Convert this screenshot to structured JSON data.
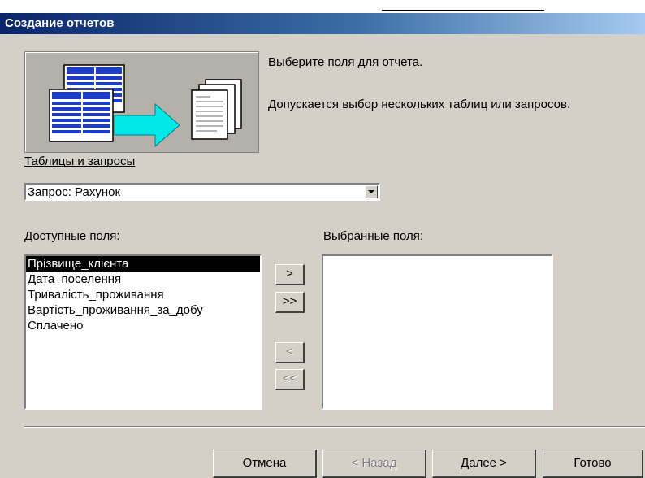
{
  "window": {
    "title": "Создание отчетов"
  },
  "intro": {
    "line1": "Выберите поля для отчета.",
    "line2": "Допускается выбор нескольких таблиц или запросов."
  },
  "tables": {
    "label": "Таблицы и запросы",
    "selected": "Запрос: Рахунок"
  },
  "available": {
    "label": "Доступные поля:",
    "items": [
      "Прізвище_клієнта",
      "Дата_поселення",
      "Тривалість_проживання",
      "Вартість_проживання_за_добу",
      "Сплачено"
    ],
    "selected_index": 0
  },
  "chosen": {
    "label": "Выбранные поля:",
    "items": []
  },
  "move_buttons": {
    "add_one": ">",
    "add_all": ">>",
    "remove_one": "<",
    "remove_all": "<<"
  },
  "footer": {
    "cancel": "Отмена",
    "back": "< Назад",
    "next": "Далее >",
    "finish": "Готово"
  },
  "colors": {
    "title_start": "#0a246a",
    "title_end": "#a6caf0",
    "dialog_bg": "#d4d0c8",
    "arrow": "#00e8e8",
    "doc_icon": "#1c3ccc"
  }
}
